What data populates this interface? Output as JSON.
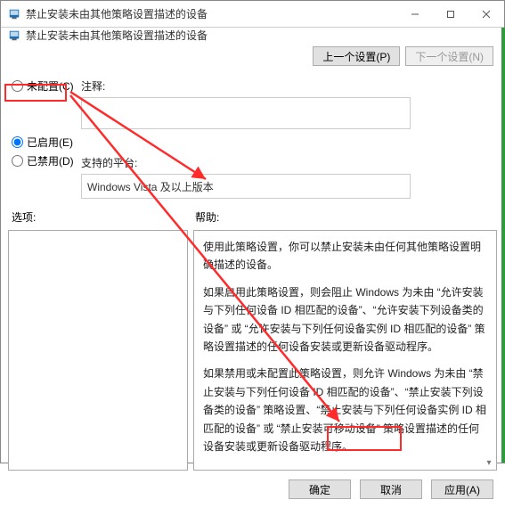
{
  "titlebar": {
    "title": "禁止安装未由其他策略设置描述的设备"
  },
  "subheader": {
    "title": "禁止安装未由其他策略设置描述的设备"
  },
  "nav": {
    "prev_label": "上一个设置(P)",
    "next_label": "下一个设置(N)"
  },
  "radios": {
    "not_configured": "未配置(C)",
    "enabled": "已启用(E)",
    "disabled": "已禁用(D)",
    "selected": "enabled"
  },
  "comment": {
    "label": "注释:",
    "value": ""
  },
  "platform": {
    "label": "支持的平台:",
    "value": "Windows Vista 及以上版本"
  },
  "panes": {
    "options_label": "选项:",
    "help_label": "帮助:"
  },
  "help": {
    "p1": "使用此策略设置，你可以禁止安装未由任何其他策略设置明确描述的设备。",
    "p2": "如果启用此策略设置，则会阻止 Windows 为未由 “允许安装与下列任何设备 ID 相匹配的设备”、“允许安装下列设备类的设备” 或 “允许安装与下列任何设备实例 ID 相匹配的设备” 策略设置描述的任何设备安装或更新设备驱动程序。",
    "p3": "如果禁用或未配置此策略设置，则允许 Windows 为未由 “禁止安装与下列任何设备 ID 相匹配的设备”、“禁止安装下列设备类的设备” 策略设置、“禁止安装与下列任何设备实例 ID 相匹配的设备” 或 “禁止安装可移动设备” 策略设置描述的任何设备安装或更新设备驱动程序。"
  },
  "footer": {
    "ok_label": "确定",
    "cancel_label": "取消",
    "apply_label": "应用(A)"
  },
  "icon_colors": {
    "gpo_icon": "#1a6fb8"
  }
}
